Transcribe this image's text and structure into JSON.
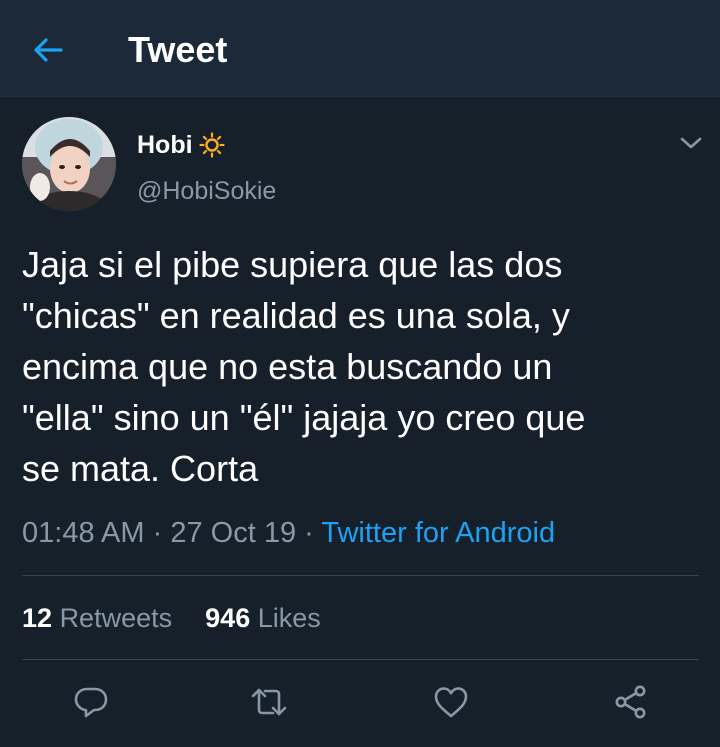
{
  "header": {
    "back_icon": "arrow-left-icon",
    "title": "Tweet"
  },
  "tweet": {
    "author": {
      "display_name": "Hobi",
      "name_emoji_icon": "sun-icon",
      "handle": "@HobiSokie"
    },
    "text": "Jaja si el pibe supiera que las dos\n\"chicas\" en realidad es una sola, y\nencima que no esta buscando un\n\"ella\" sino un \"él\" jajaja yo creo que\nse mata. Corta",
    "time": "01:48 AM",
    "date": "27 Oct 19",
    "separator": "·",
    "source": "Twitter for Android",
    "stats": {
      "retweets_count": "12",
      "retweets_label": "Retweets",
      "likes_count": "946",
      "likes_label": "Likes"
    },
    "actions": [
      "reply-icon",
      "retweet-icon",
      "like-icon",
      "share-icon"
    ]
  },
  "colors": {
    "background": "#15202b",
    "header_background": "#1c2938",
    "accent": "#1da1f2",
    "secondary_text": "#8899a6",
    "divider": "#38444d"
  }
}
